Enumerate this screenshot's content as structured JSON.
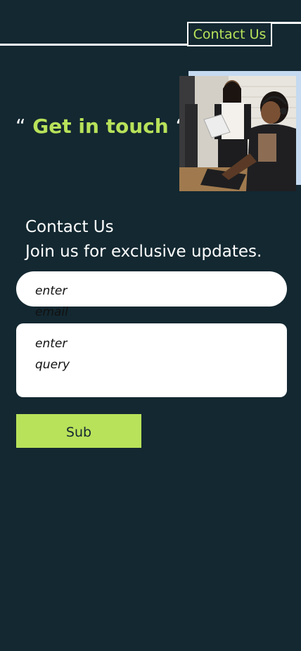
{
  "header": {
    "nav_label": "Contact Us"
  },
  "hero": {
    "quote_open": "“",
    "title": "Get in touch",
    "quote_close": "“",
    "image_icon": "photo-call-center"
  },
  "contact": {
    "title": "Contact Us",
    "subtitle": "Join us for exclusive updates."
  },
  "form": {
    "email_placeholder": "enter email",
    "query_placeholder": "enter query",
    "submit_label": "Sub"
  },
  "colors": {
    "background": "#132831",
    "accent": "#b8e25a",
    "photo_backdrop": "#c5daf0"
  }
}
